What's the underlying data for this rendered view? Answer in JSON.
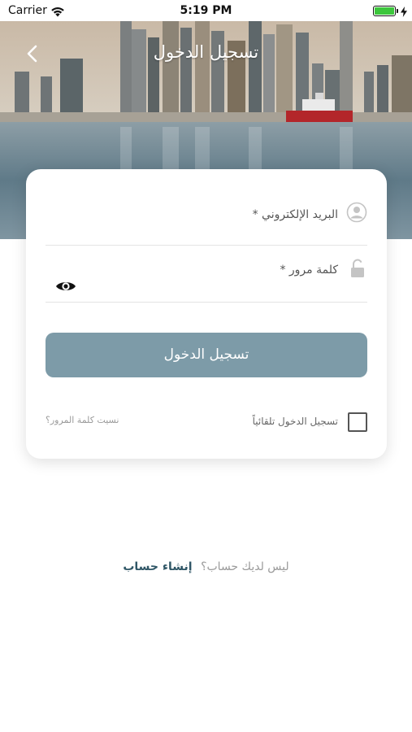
{
  "status_bar": {
    "carrier": "Carrier",
    "time": "5:19 PM",
    "battery_level": 1.0
  },
  "header": {
    "title": "تسجيل الدخول",
    "back_icon": "chevron-left-icon"
  },
  "form": {
    "email_label": "البريد الإلكتروني *",
    "email_icon": "user-circle-icon",
    "password_label": "كلمة مرور *",
    "password_icon": "unlock-icon",
    "show_password_icon": "eye-icon",
    "login_button": "تسجيل الدخول",
    "remember_label": "تسجيل الدخول تلقائياً",
    "remember_checked": false,
    "forgot_link": "نسيت كلمة المرور؟"
  },
  "footer": {
    "prompt": "ليس لديك حساب؟",
    "signup_link": "إنشاء حساب"
  },
  "colors": {
    "button": "#7d9ba8",
    "link": "#2f5666",
    "battery": "#3cc63c"
  }
}
